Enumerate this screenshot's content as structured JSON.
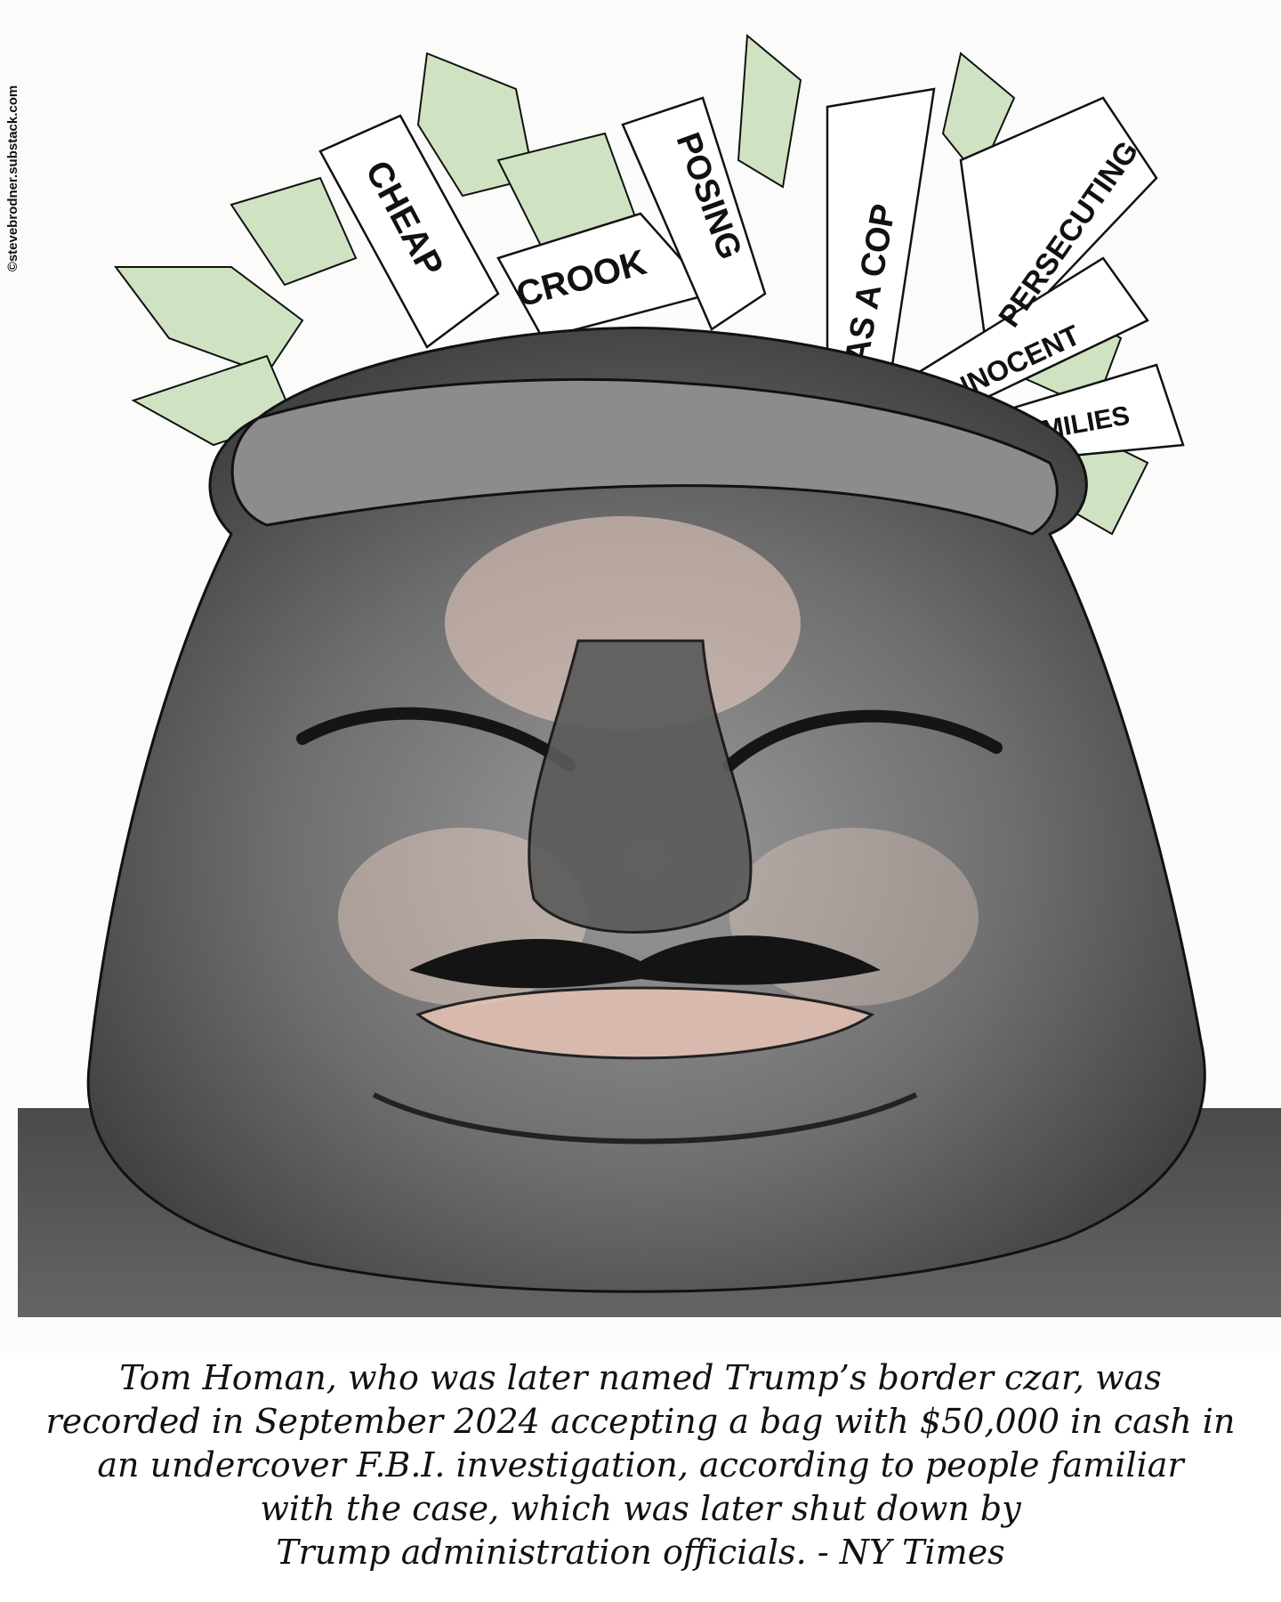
{
  "credit": "©stevebrodner.substack.com",
  "notes": [
    {
      "text": "CHEAP"
    },
    {
      "text": "CROOK"
    },
    {
      "text": "POSING"
    },
    {
      "text": "AS A COP"
    },
    {
      "text": "PERSECUTING"
    },
    {
      "text": "INNOCENT"
    },
    {
      "text": "FAMILIES"
    }
  ],
  "caption_lines": [
    "Tom Homan, who was later named Trump’s border czar, was",
    "recorded in September 2024 accepting a bag with $50,000 in cash in",
    "an undercover F.B.I. investigation, according to people familiar",
    "with the case, which was later shut down by",
    "Trump administration officials. - NY Times"
  ],
  "colors": {
    "money_green": "#cfe3c2",
    "skin_pink": "#f2d4c8",
    "graphite": "#3a3a3a",
    "ink": "#111111"
  }
}
